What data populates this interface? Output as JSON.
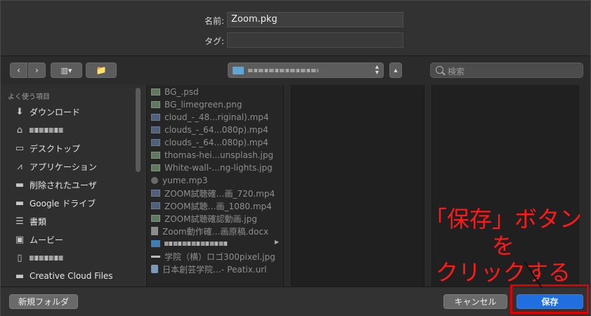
{
  "window": {
    "name_label": "名前:",
    "name_value": "Zoom.pkg",
    "tag_label": "タグ:"
  },
  "toolbar": {
    "back_icon": "chevron-left",
    "forward_icon": "chevron-right",
    "view_icon": "column-view",
    "new_folder_icon": "new-folder",
    "search_placeholder": "検索"
  },
  "sidebar": {
    "heading": "よく使う項目",
    "items": [
      {
        "label": "ダウンロード",
        "icon": "download-icon"
      },
      {
        "label": "",
        "icon": "home-icon"
      },
      {
        "label": "デスクトップ",
        "icon": "desktop-icon"
      },
      {
        "label": "アプリケーション",
        "icon": "applications-icon"
      },
      {
        "label": "削除されたユーザ",
        "icon": "folder-icon"
      },
      {
        "label": "Google ドライブ",
        "icon": "folder-icon"
      },
      {
        "label": "書類",
        "icon": "document-icon"
      },
      {
        "label": "ムービー",
        "icon": "movie-icon"
      },
      {
        "label": "",
        "icon": "file-icon"
      },
      {
        "label": "Creative Cloud Files",
        "icon": "folder-icon"
      }
    ]
  },
  "files": [
    {
      "name": "BG_.psd",
      "type": "img"
    },
    {
      "name": "BG_limegreen.png",
      "type": "img"
    },
    {
      "name": "cloud_-_48...riginal).mp4",
      "type": "mov"
    },
    {
      "name": "clouds_-_64...080p).mp4",
      "type": "mov"
    },
    {
      "name": "clouds_-_64...080p).mp4",
      "type": "mov"
    },
    {
      "name": "thomas-hei...unsplash.jpg",
      "type": "img"
    },
    {
      "name": "White-wall-...ng-lights.jpg",
      "type": "img"
    },
    {
      "name": "yume.mp3",
      "type": "aud"
    },
    {
      "name": "ZOOM試聴確…画_720.mp4",
      "type": "mov"
    },
    {
      "name": "ZOOM試聴…画_1080.mp4",
      "type": "mov"
    },
    {
      "name": "ZOOM試聴確認動画.jpg",
      "type": "img"
    },
    {
      "name": "Zoom動作確…画原稿.docx",
      "type": "doc"
    },
    {
      "name": "",
      "type": "fold"
    },
    {
      "name": "学院（横）ロゴ300pixel.jpg",
      "type": "line"
    },
    {
      "name": "日本創芸学院…- Peatix.url",
      "type": "url"
    }
  ],
  "bottom": {
    "new_folder": "新規フォルダ",
    "cancel": "キャンセル",
    "save": "保存"
  },
  "annotation": {
    "line1": "「保存」ボタンを",
    "line2": "クリックする"
  },
  "colors": {
    "save_button": "#1f6fe0",
    "annotation": "#ff1a1a"
  }
}
